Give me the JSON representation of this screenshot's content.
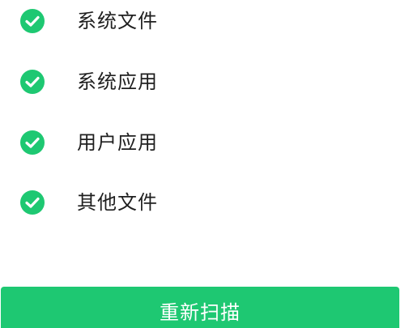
{
  "colors": {
    "accent": "#1ec872",
    "text": "#1f1f1f",
    "button_text": "#ffffff",
    "background": "#ffffff"
  },
  "scan_items": [
    {
      "label": "系统文件",
      "status": "done",
      "icon": "check-circle-icon"
    },
    {
      "label": "系统应用",
      "status": "done",
      "icon": "check-circle-icon"
    },
    {
      "label": "用户应用",
      "status": "done",
      "icon": "check-circle-icon"
    },
    {
      "label": "其他文件",
      "status": "done",
      "icon": "check-circle-icon"
    }
  ],
  "actions": {
    "rescan_label": "重新扫描"
  }
}
